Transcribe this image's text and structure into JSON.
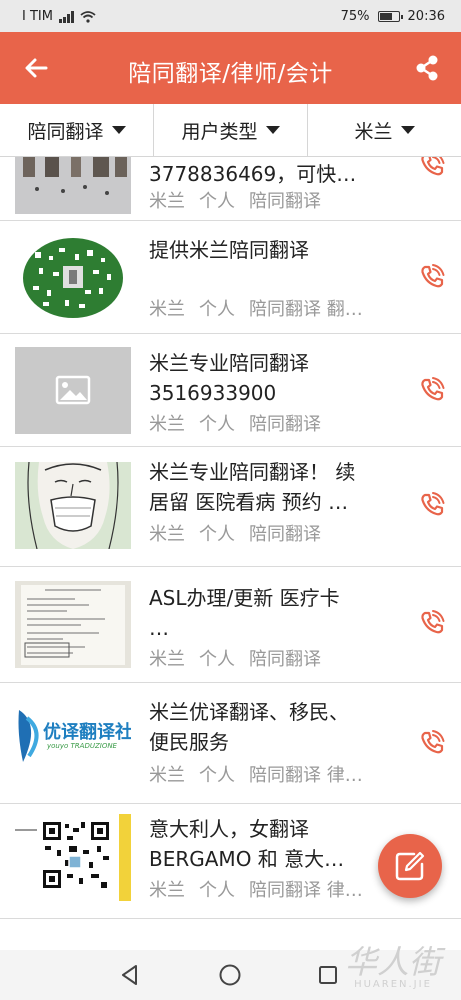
{
  "status_bar": {
    "carrier": "I TIM",
    "battery": "75%",
    "battery_level": 0.75,
    "time": "20:36"
  },
  "header": {
    "title": "陪同翻译/律师/会计",
    "back_icon": "arrow-left-icon",
    "share_icon": "share-icon"
  },
  "filters": [
    {
      "label": "陪同翻译"
    },
    {
      "label": "用户类型"
    },
    {
      "label": "米兰"
    }
  ],
  "listings": [
    {
      "title": "3778836469，可快…",
      "city": "米兰",
      "user_type": "个人",
      "tags": "陪同翻译"
    },
    {
      "title": "提供米兰陪同翻译",
      "city": "米兰",
      "user_type": "个人",
      "tags": "陪同翻译 翻…"
    },
    {
      "title": "米兰专业陪同翻译\n3516933900",
      "city": "米兰",
      "user_type": "个人",
      "tags": "陪同翻译"
    },
    {
      "title": "米兰专业陪同翻译！ 续\n居留 医院看病 预约 …",
      "city": "米兰",
      "user_type": "个人",
      "tags": "陪同翻译"
    },
    {
      "title": "ASL办理/更新 医疗卡\n…",
      "city": "米兰",
      "user_type": "个人",
      "tags": "陪同翻译"
    },
    {
      "title": "米兰优译翻译、移民、\n便民服务",
      "city": "米兰",
      "user_type": "个人",
      "tags": "陪同翻译 律…"
    },
    {
      "title": "意大利人，女翻译\nBERGAMO 和 意大…",
      "city": "米兰",
      "user_type": "个人",
      "tags": "陪同翻译 律…"
    }
  ],
  "thumb_texts": {
    "logo_main": "优译翻译社",
    "logo_sub": "youyo TRADUZIONE"
  },
  "fab": {
    "icon": "edit-icon"
  },
  "nav_bar": {
    "back": "triangle-back-icon",
    "home": "circle-home-icon",
    "recent": "square-recent-icon"
  },
  "watermark": {
    "text": "华人街",
    "sub": "HUAREN.JIE"
  },
  "colors": {
    "accent": "#e8644a",
    "meta": "#999999"
  }
}
